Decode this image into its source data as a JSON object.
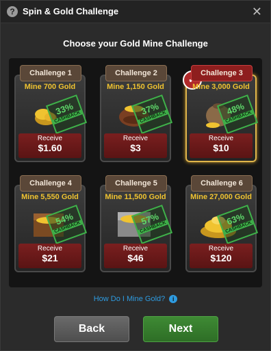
{
  "header": {
    "title": "Spin & Gold Challenge",
    "help_icon": "?",
    "close_icon": "✕"
  },
  "subtitle": "Choose your Gold Mine Challenge",
  "cards": [
    {
      "tag": "Challenge 1",
      "mine": "Mine 700 Gold",
      "cashback_pct": "33%",
      "cashback_label": "CASHBACK",
      "receive_label": "Receive",
      "receive_value": "$1.60",
      "selected": false
    },
    {
      "tag": "Challenge 2",
      "mine": "Mine 1,150 Gold",
      "cashback_pct": "37%",
      "cashback_label": "CASHBACK",
      "receive_label": "Receive",
      "receive_value": "$3",
      "selected": false
    },
    {
      "tag": "Challenge 3",
      "mine": "Mine 3,000 Gold",
      "cashback_pct": "48%",
      "cashback_label": "CASHBACK",
      "receive_label": "Receive",
      "receive_value": "$10",
      "selected": true
    },
    {
      "tag": "Challenge 4",
      "mine": "Mine 5,550 Gold",
      "cashback_pct": "54%",
      "cashback_label": "CASHBACK",
      "receive_label": "Receive",
      "receive_value": "$21",
      "selected": false
    },
    {
      "tag": "Challenge 5",
      "mine": "Mine 11,500 Gold",
      "cashback_pct": "57%",
      "cashback_label": "CASHBACK",
      "receive_label": "Receive",
      "receive_value": "$46",
      "selected": false
    },
    {
      "tag": "Challenge 6",
      "mine": "Mine 27,000 Gold",
      "cashback_pct": "63%",
      "cashback_label": "CASHBACK",
      "receive_label": "Receive",
      "receive_value": "$120",
      "selected": false
    }
  ],
  "howto": {
    "label": "How Do I Mine Gold?",
    "icon": "i"
  },
  "buttons": {
    "back": "Back",
    "next": "Next"
  },
  "colors": {
    "gold_text": "#f0c330",
    "cashback_green": "#3fb24a",
    "selected_border": "#e0b54a",
    "link_blue": "#2e9be0",
    "next_green": "#3e8a34"
  }
}
